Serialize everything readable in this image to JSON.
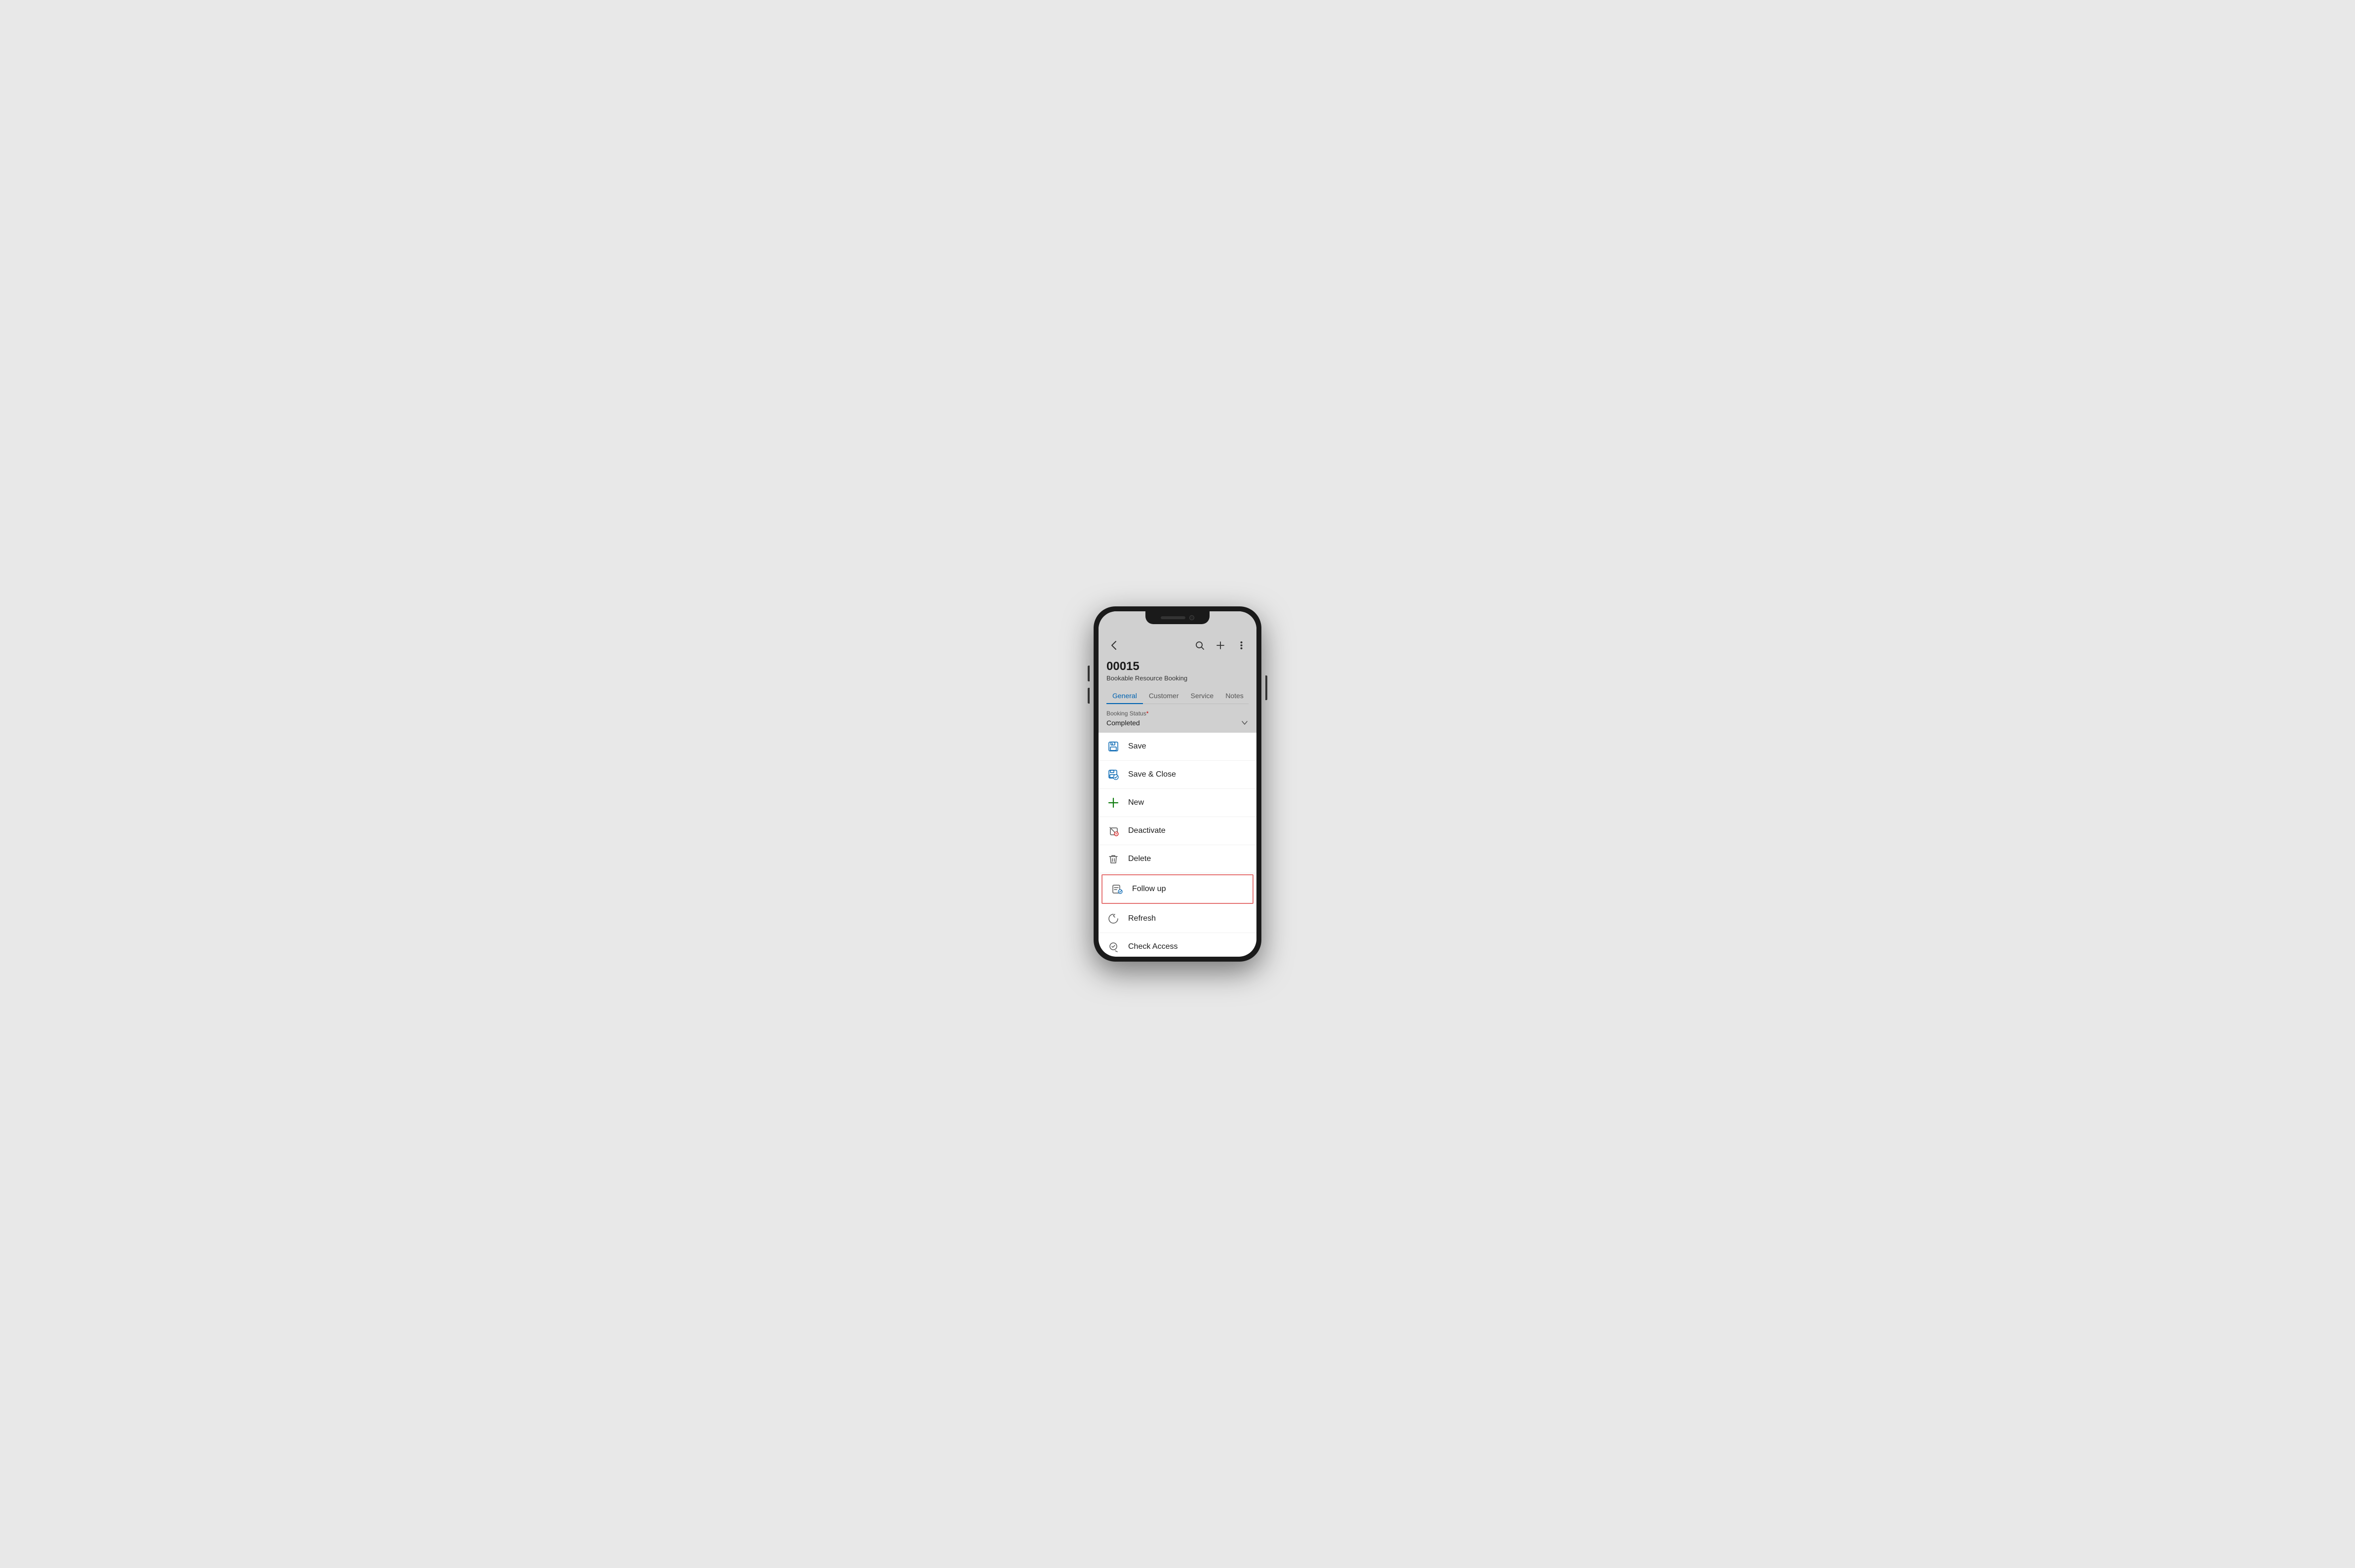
{
  "phone": {
    "title": "Phone"
  },
  "header": {
    "record_id": "00015",
    "record_type": "Bookable Resource Booking",
    "back_label": "‹",
    "search_label": "⌕",
    "add_label": "+",
    "more_label": "⋮"
  },
  "tabs": [
    {
      "id": "general",
      "label": "General",
      "active": true
    },
    {
      "id": "customer",
      "label": "Customer",
      "active": false
    },
    {
      "id": "service",
      "label": "Service",
      "active": false
    },
    {
      "id": "notes",
      "label": "Notes",
      "active": false
    }
  ],
  "booking_status": {
    "label": "Booking Status",
    "required": "*",
    "value": "Completed",
    "chevron": "⌄"
  },
  "menu_items": [
    {
      "id": "save",
      "label": "Save",
      "icon": "save-icon",
      "highlighted": false
    },
    {
      "id": "save-close",
      "label": "Save & Close",
      "icon": "save-close-icon",
      "highlighted": false
    },
    {
      "id": "new",
      "label": "New",
      "icon": "new-icon",
      "highlighted": false
    },
    {
      "id": "deactivate",
      "label": "Deactivate",
      "icon": "deactivate-icon",
      "highlighted": false
    },
    {
      "id": "delete",
      "label": "Delete",
      "icon": "delete-icon",
      "highlighted": false
    },
    {
      "id": "follow-up",
      "label": "Follow up",
      "icon": "followup-icon",
      "highlighted": true
    },
    {
      "id": "refresh",
      "label": "Refresh",
      "icon": "refresh-icon",
      "highlighted": false
    },
    {
      "id": "check-access",
      "label": "Check Access",
      "icon": "checkaccess-icon",
      "highlighted": false
    }
  ]
}
